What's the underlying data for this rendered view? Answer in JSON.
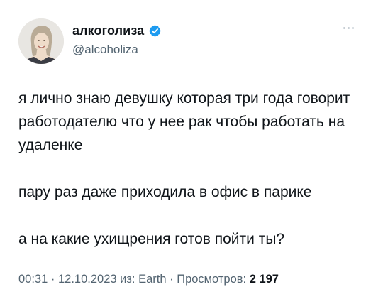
{
  "author": {
    "display_name": "алкоголиза",
    "handle": "@alcoholiza",
    "verified_color": "#1d9bf0"
  },
  "tweet": {
    "paragraphs": [
      "я лично знаю девушку которая три года говорит работодателю что у нее рак чтобы работать на удаленке",
      "пару раз даже приходила в офис в парике",
      "а на какие ухищрения готов пойти ты?"
    ]
  },
  "meta": {
    "time": "00:31",
    "separator1": " · ",
    "date": "12.10.2023",
    "source": " из: Earth",
    "separator2": " · ",
    "views_label": "Просмотров: ",
    "views_count": "2 197"
  },
  "icons": {
    "more": "more-horizontal-icon",
    "verified": "verified-badge-icon"
  }
}
